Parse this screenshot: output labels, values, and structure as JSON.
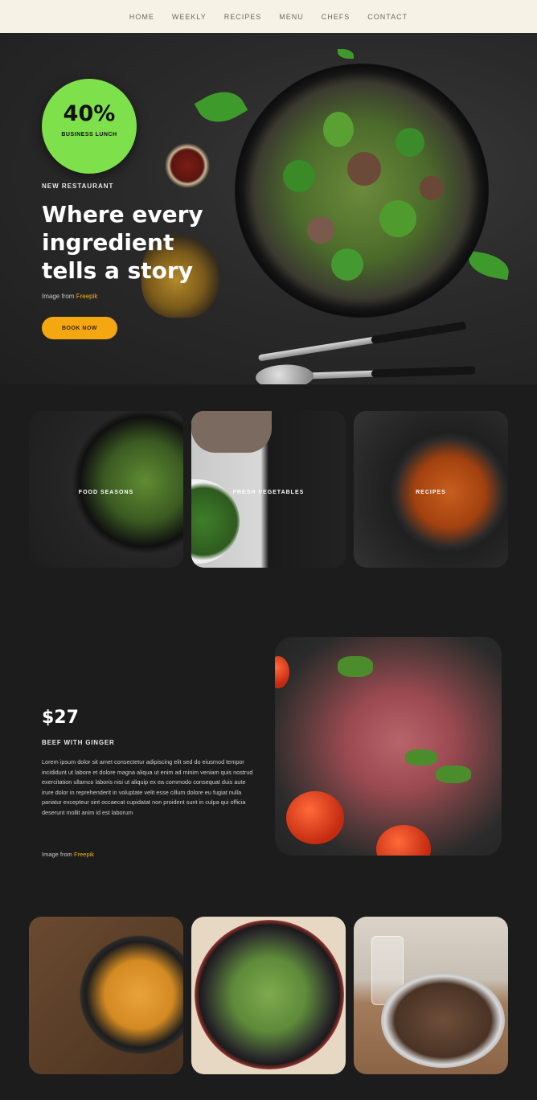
{
  "nav": {
    "items": [
      "Home",
      "Weekly",
      "Recipes",
      "Menu",
      "Chefs",
      "Contact"
    ]
  },
  "hero": {
    "badge_percent": "40%",
    "badge_text": "Business Lunch",
    "eyebrow": "New Restaurant",
    "title": "Where every ingredient tells a story",
    "credit_prefix": "Image from",
    "credit_source": "Freepik",
    "cta_label": "Book Now"
  },
  "gallery": {
    "cards": [
      {
        "label": "Food Seasons"
      },
      {
        "label": "Fresh Vegetables"
      },
      {
        "label": "Recipes"
      }
    ]
  },
  "feature": {
    "price": "$27",
    "subtitle": "Beef with Ginger",
    "body": "Lorem ipsum dolor sit amet consectetur adipiscing elit sed do eiusmod tempor incididunt ut labore et dolore magna aliqua ut enim ad minim veniam quis nostrud exercitation ullamco laboris nisi ut aliquip ex ea commodo consequat duis aute irure dolor in reprehenderit in voluptate velit esse cillum dolore eu fugiat nulla pariatur excepteur sint occaecat cupidatat non proident sunt in culpa qui officia deserunt mollit anim id est laborum",
    "credit_prefix": "Image from",
    "credit_source": "Freepik"
  },
  "colors": {
    "nav_bg": "#f6f2e6",
    "page_bg": "#1c1c1c",
    "badge": "#7ee04b",
    "accent": "#f5a711"
  }
}
